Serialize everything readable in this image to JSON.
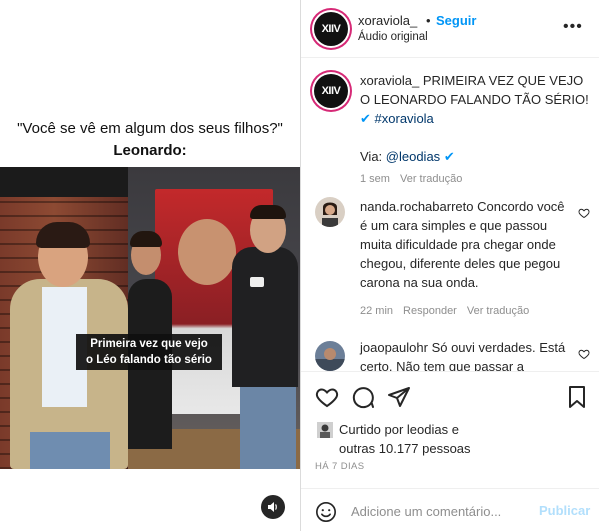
{
  "media": {
    "caption_line1": "\"Você se vê em algum dos seus filhos?\"",
    "caption_line2": "Leonardo:",
    "overlay_line1": "Primeira vez que vejo",
    "overlay_line2": "o Léo falando tão sério",
    "mute_icon": "speaker-icon"
  },
  "header": {
    "avatar_text": "XIIV",
    "username": "xoraviola_",
    "dot": "•",
    "follow_label": "Seguir",
    "audio_label": "Áudio original",
    "more_icon": "more-icon"
  },
  "caption": {
    "username": "xoraviola_",
    "text": " PRIMEIRA VEZ QUE VEJO O LEONARDO FALANDO TÃO SÉRIO! ",
    "hashtag": "#xoraviola",
    "via_label": "Via: ",
    "via_user": "@leodias",
    "time": "1 sem",
    "translate": "Ver tradução"
  },
  "comments": [
    {
      "username": "nanda.rochabarreto",
      "text": " Concordo você é um cara simples e que passou muita dificuldade pra chegar onde chegou, diferente deles que pegou carona na sua onda.",
      "time": "22 min",
      "reply": "Responder",
      "translate": "Ver tradução"
    },
    {
      "username": "joaopaulohr",
      "text": " Só ouvi verdades. Está certo. Não tem que passar a"
    }
  ],
  "actions": {
    "liked_prefix": "Curtido por ",
    "liked_user": "leodias",
    "liked_middle": " e",
    "liked_others": "outras 10.177 pessoas",
    "ago": "HÁ 7 DIAS"
  },
  "add_comment": {
    "placeholder": "Adicione um comentário...",
    "publish_label": "Publicar"
  },
  "colors": {
    "accent": "#0095f6",
    "story_ring": "#d62976",
    "publish_disabled": "#b2dffc"
  }
}
